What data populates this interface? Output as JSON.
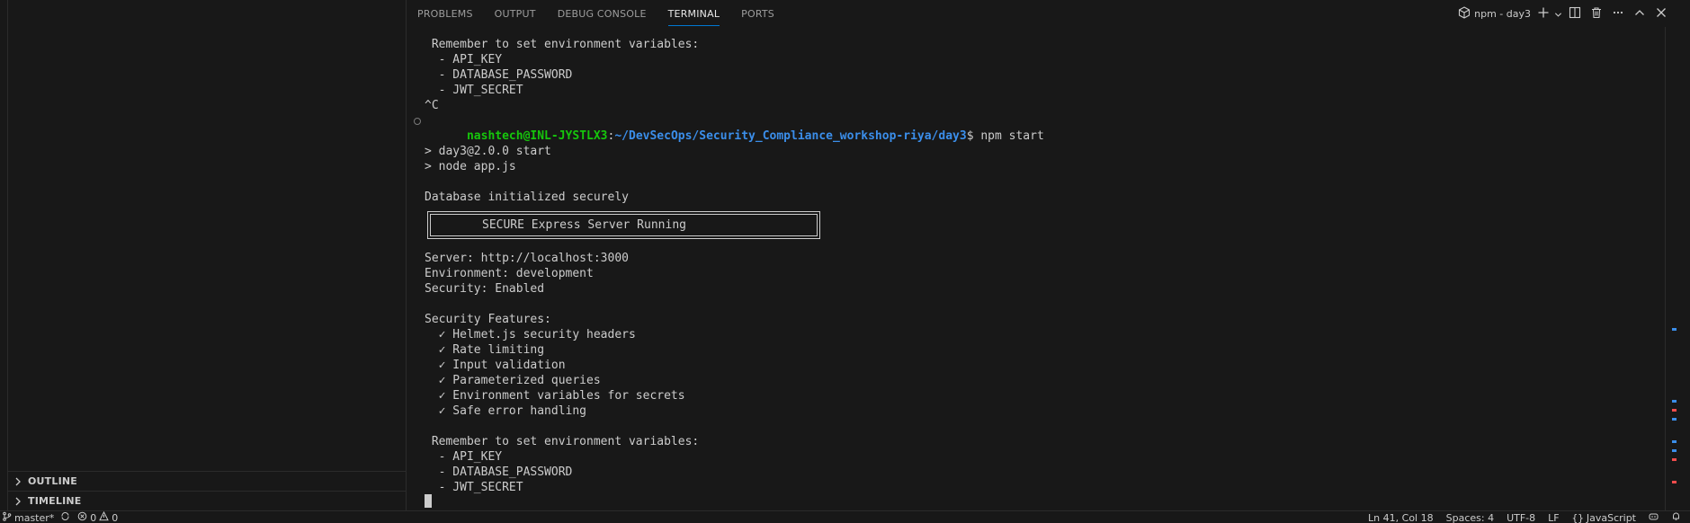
{
  "sidebar": {
    "sections": [
      {
        "label": "OUTLINE"
      },
      {
        "label": "TIMELINE"
      }
    ]
  },
  "panel": {
    "tabs": [
      {
        "label": "PROBLEMS",
        "active": false
      },
      {
        "label": "OUTPUT",
        "active": false
      },
      {
        "label": "DEBUG CONSOLE",
        "active": false
      },
      {
        "label": "TERMINAL",
        "active": true
      },
      {
        "label": "PORTS",
        "active": false
      }
    ],
    "terminal_name": "npm - day3",
    "icons": [
      "terminal-icon",
      "plus-icon",
      "chevron-down-icon",
      "split-icon",
      "trash-icon",
      "ellipsis-icon",
      "chevron-up-icon",
      "close-icon"
    ]
  },
  "terminal": {
    "lines_top": [
      " Remember to set environment variables:",
      "  - API_KEY",
      "  - DATABASE_PASSWORD",
      "  - JWT_SECRET",
      "^C"
    ],
    "prompt": {
      "user_host": "nashtech@INL-JYSTLX3",
      "separator": ":",
      "path": "~/DevSecOps/Security_Compliance_workshop-riya/day3",
      "dollar": "$ ",
      "command": "npm start"
    },
    "npm_lines": [
      "> day3@2.0.0 start",
      "> node app.js"
    ],
    "db_line": "Database initialized securely",
    "banner": "SECURE Express Server Running",
    "info_lines": [
      "Server: http://localhost:3000",
      "Environment: development",
      "Security: Enabled"
    ],
    "features_header": "Security Features:",
    "features": [
      "  ✓ Helmet.js security headers",
      "  ✓ Rate limiting",
      "  ✓ Input validation",
      "  ✓ Parameterized queries",
      "  ✓ Environment variables for secrets",
      "  ✓ Safe error handling"
    ],
    "lines_bottom": [
      " Remember to set environment variables:",
      "  - API_KEY",
      "  - DATABASE_PASSWORD",
      "  - JWT_SECRET"
    ]
  },
  "statusbar": {
    "branch": "master*",
    "errors": "0",
    "warnings": "0",
    "position": "Ln 41, Col 18",
    "spaces": "Spaces: 4",
    "encoding": "UTF-8",
    "eol": "LF",
    "language": "JavaScript"
  },
  "colors": {
    "background": "#181818",
    "accent": "#0078d4",
    "prompt_user": "#16c60c",
    "prompt_path": "#3b8eea"
  }
}
